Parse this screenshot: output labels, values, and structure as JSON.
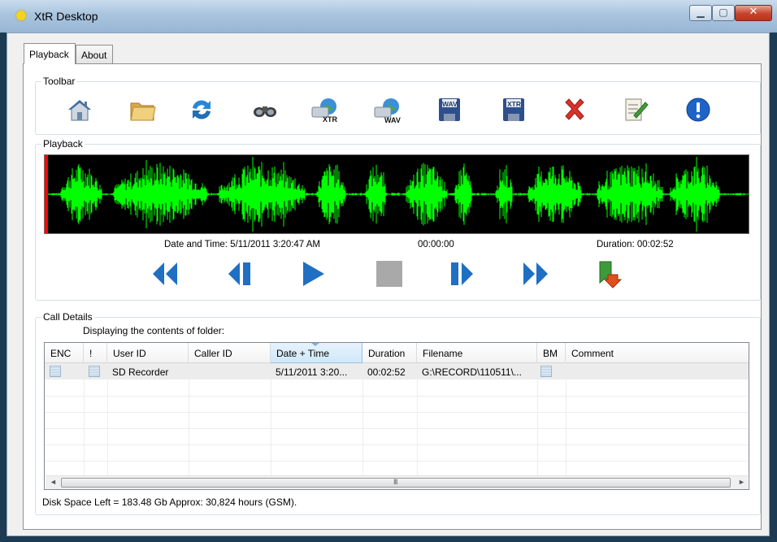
{
  "window": {
    "title": "XtR Desktop"
  },
  "window_controls": {
    "minimize": "▁",
    "maximize": "▢",
    "close": "✕"
  },
  "tabs": [
    {
      "label": "Playback"
    },
    {
      "label": "About"
    }
  ],
  "toolbar": {
    "legend": "Toolbar",
    "buttons": [
      {
        "name": "home-icon"
      },
      {
        "name": "folder-icon"
      },
      {
        "name": "refresh-icon"
      },
      {
        "name": "binoculars-icon"
      },
      {
        "name": "export-xtr-globe-icon",
        "caption": "XTR"
      },
      {
        "name": "export-wav-globe-icon",
        "caption": "WAV"
      },
      {
        "name": "save-wav-icon",
        "caption": "WAV"
      },
      {
        "name": "save-xtr-icon",
        "caption": "XTR"
      },
      {
        "name": "delete-icon"
      },
      {
        "name": "edit-notes-icon"
      },
      {
        "name": "info-icon"
      }
    ]
  },
  "playback": {
    "legend": "Playback",
    "date_time": "Date and Time:  5/11/2011 3:20:47 AM",
    "position": "00:00:00",
    "duration": "Duration:  00:02:52",
    "waveform_color": "#00ff00",
    "cursor_color": "#ff0000"
  },
  "call_details": {
    "legend": "Call Details",
    "folder_text": "Displaying the contents of folder:",
    "columns": [
      "ENC",
      "!",
      "User ID",
      "Caller ID",
      "Date + Time",
      "Duration",
      "Filename",
      "BM",
      "Comment"
    ],
    "rows": [
      {
        "user_id": "SD Recorder",
        "caller_id": "",
        "date_time": "5/11/2011 3:20...",
        "duration": "00:02:52",
        "filename": "G:\\RECORD\\110511\\...",
        "comment": ""
      }
    ],
    "scroll_left": "◄",
    "scroll_right": "►",
    "scroll_grip": "III"
  },
  "status": {
    "disk_space": "Disk Space Left = 183.48 Gb  Approx: 30,824 hours (GSM)."
  }
}
